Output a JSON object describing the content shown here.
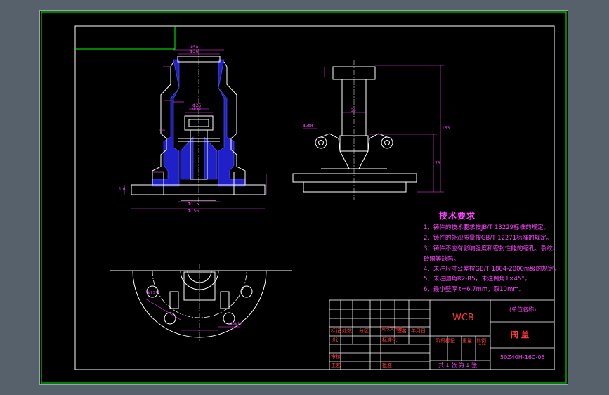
{
  "technical_requirements": {
    "title": "技术要求",
    "items": [
      "1、铸件的技术要求按JB/T 13229标准的规定。",
      "2、铸件的外观质量按GB/T 12271标准的规定。",
      "3、铸件不应有影响强度和密封性能的缩孔、裂纹、",
      "砂眼等缺陷。",
      "4、未注尺寸公差按GB/T 1804-2000m级的规定。",
      "5、未注圆角R2-R5，未注倒角1×45°。",
      "6、最小壁厚 t=6.7mm，取10mm。"
    ]
  },
  "title_block": {
    "material": "WCB",
    "unit_name": "(单位名称)",
    "part_name": "阀盖",
    "drawing_code": "50Z40H-16C-05",
    "sheet_info": "共 1 张   第 1 张",
    "scale_value": "1:1",
    "headers": {
      "mark": "标记",
      "count": "处数",
      "zone": "分区",
      "change_doc": "更改文件号",
      "signature": "签名",
      "date": "年月日",
      "design": "设计",
      "standardization": "标准化",
      "review": "审核",
      "process": "工艺",
      "approve": "批准",
      "stage_mark": "阶段标记",
      "weight": "重量",
      "scale": "比例"
    }
  },
  "dimensions": {
    "top_dia": "Φ36",
    "upper_dia_1": "Φ50",
    "upper_dia_2": "Φ58",
    "mid_dia_1": "Φ32",
    "mid_dia_2": "Φ26",
    "bottom_dia_1": "Φ115",
    "bottom_dia_2": "Φ156",
    "left_height": "1.6",
    "side_height_1": "153",
    "side_height_2": "73",
    "side_width": "50",
    "side_hole": "4-Φ8",
    "bolt_circle": "Φ125",
    "bolt_holes": "4-Φ18"
  },
  "colors": {
    "sheet_bg": "#000000",
    "frame_green": "#00ff00",
    "outline_white": "#ffffff",
    "dimension_magenta": "#ff44ff",
    "hatch_blue": "#3c3cff",
    "title_red": "#ff3b3b"
  }
}
